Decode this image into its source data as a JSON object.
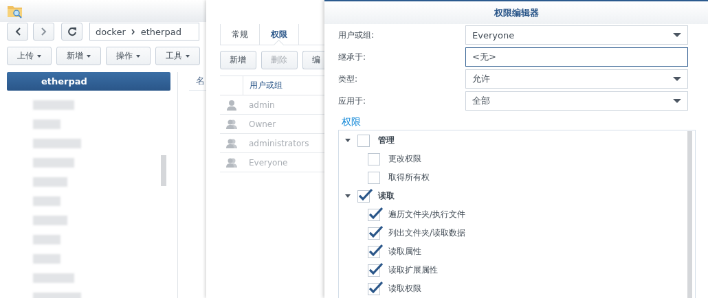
{
  "file_station": {
    "path": [
      "docker",
      "etherpad"
    ],
    "toolbar": [
      {
        "label": "上传"
      },
      {
        "label": "新增"
      },
      {
        "label": "操作"
      },
      {
        "label": "工具"
      }
    ],
    "sidebar": {
      "items": [
        {
          "label": "etherpad",
          "selected": true
        }
      ]
    },
    "list": {
      "columns": [
        "名"
      ]
    }
  },
  "properties": {
    "tabs": [
      {
        "label": "常规",
        "selected": false
      },
      {
        "label": "权限",
        "selected": true
      }
    ],
    "buttons": [
      {
        "label": "新增",
        "disabled": false
      },
      {
        "label": "删除",
        "disabled": true
      },
      {
        "label": "编",
        "disabled": false
      }
    ],
    "table": {
      "columns": [
        "用户或组"
      ],
      "rows": [
        {
          "kind": "user",
          "name": "admin"
        },
        {
          "kind": "group",
          "name": "Owner"
        },
        {
          "kind": "group",
          "name": "administrators"
        },
        {
          "kind": "group",
          "name": "Everyone"
        }
      ]
    }
  },
  "editor": {
    "title": "权限编辑器",
    "fields": [
      {
        "label": "用户或组:",
        "kind": "dropdown",
        "value": "Everyone",
        "focused": false
      },
      {
        "label": "继承于:",
        "kind": "text",
        "value": "<无>",
        "focused": true
      },
      {
        "label": "类型:",
        "kind": "dropdown",
        "value": "允许",
        "focused": false
      },
      {
        "label": "应用于:",
        "kind": "dropdown",
        "value": "全部",
        "focused": false
      }
    ],
    "section": "权限",
    "permissions": [
      {
        "label": "管理",
        "checked": false,
        "expanded": true,
        "children": [
          {
            "label": "更改权限",
            "checked": false
          },
          {
            "label": "取得所有权",
            "checked": false
          }
        ]
      },
      {
        "label": "读取",
        "checked": true,
        "expanded": true,
        "children": [
          {
            "label": "遍历文件夹/执行文件",
            "checked": true
          },
          {
            "label": "列出文件夹/读取数据",
            "checked": true
          },
          {
            "label": "读取属性",
            "checked": true
          },
          {
            "label": "读取扩展属性",
            "checked": true
          },
          {
            "label": "读取权限",
            "checked": true
          }
        ]
      }
    ]
  }
}
